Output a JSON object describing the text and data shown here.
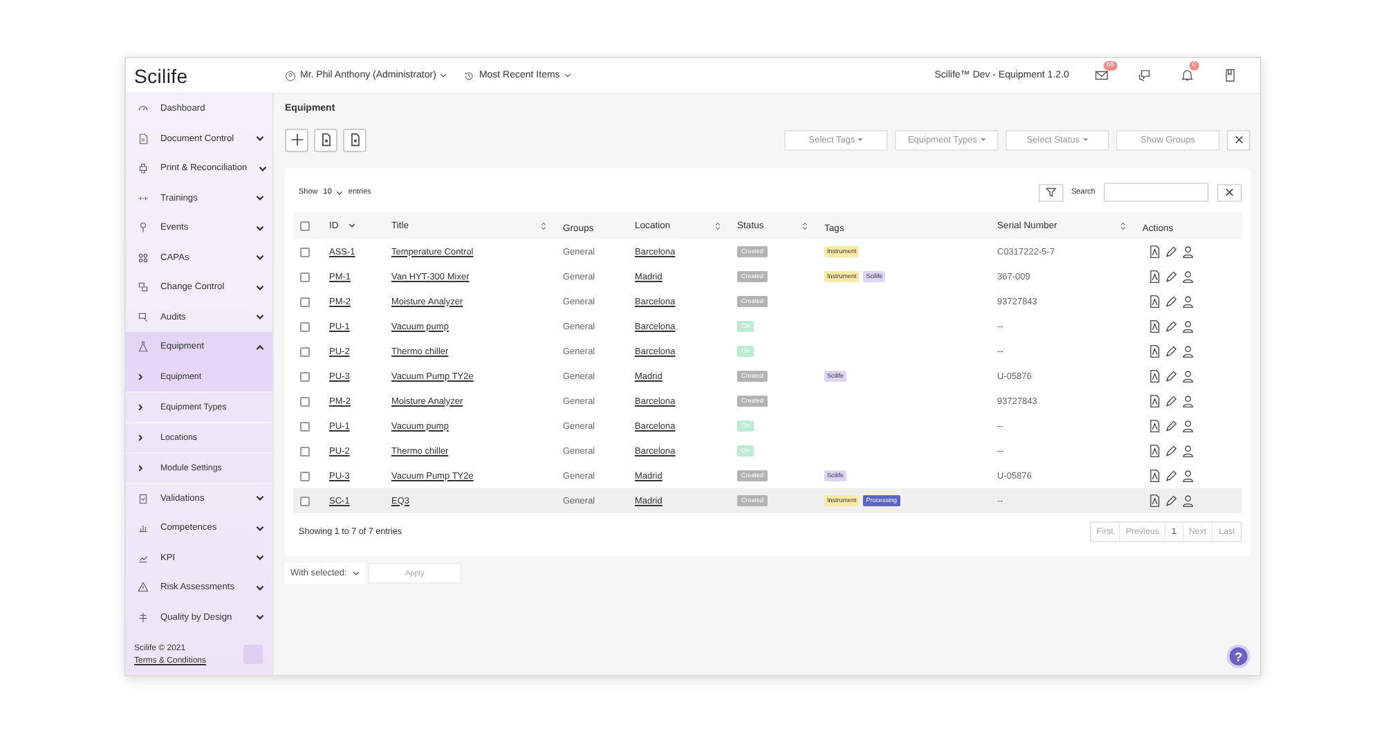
{
  "topbar": {
    "logo": "Scilife",
    "user": "Mr. Phil Anthony (Administrator)",
    "recent": "Most Recent Items",
    "env": "Scilife™ Dev - Equipment 1.2.0",
    "mail_badge": "68",
    "bell_badge": "0"
  },
  "sidebar": {
    "items": [
      {
        "label": "Dashboard",
        "expandable": false,
        "selected": false
      },
      {
        "label": "Document Control",
        "expandable": true,
        "expanded": false,
        "selected": false
      },
      {
        "label": "Print & Reconciliation",
        "expandable": true,
        "expanded": false,
        "selected": false
      },
      {
        "label": "Trainings",
        "expandable": true,
        "expanded": false,
        "selected": false
      },
      {
        "label": "Events",
        "expandable": true,
        "expanded": false,
        "selected": false
      },
      {
        "label": "CAPAs",
        "expandable": true,
        "expanded": false,
        "selected": false
      },
      {
        "label": "Change Control",
        "expandable": true,
        "expanded": false,
        "selected": false
      },
      {
        "label": "Audits",
        "expandable": true,
        "expanded": false,
        "selected": false
      },
      {
        "label": "Equipment",
        "expandable": true,
        "expanded": true,
        "selected": true,
        "children": [
          {
            "label": "Equipment",
            "selected": true
          },
          {
            "label": "Equipment Types",
            "selected": false
          },
          {
            "label": "Locations",
            "selected": false
          },
          {
            "label": "Module Settings",
            "selected": false
          }
        ]
      },
      {
        "label": "Validations",
        "expandable": true,
        "expanded": false,
        "selected": false
      },
      {
        "label": "Competences",
        "expandable": true,
        "expanded": false,
        "selected": false
      },
      {
        "label": "KPI",
        "expandable": true,
        "expanded": false,
        "selected": false
      },
      {
        "label": "Risk Assessments",
        "expandable": true,
        "expanded": false,
        "selected": false
      },
      {
        "label": "Quality by Design",
        "expandable": true,
        "expanded": false,
        "selected": false
      }
    ],
    "copyright": "Scilife © 2021",
    "terms": "Terms & Conditions"
  },
  "page": {
    "title": "Equipment",
    "filters": [
      "Select Tags",
      "Equipment Types",
      "Select Status"
    ],
    "show_groups": "Show Groups"
  },
  "table": {
    "show": "Show",
    "length": "10",
    "entries": "entries",
    "search_label": "Search",
    "select_all_checked": false,
    "columns": [
      {
        "label": "ID",
        "sortable": true,
        "sorted": true
      },
      {
        "label": "Title",
        "sortable": true,
        "sorted": false
      },
      {
        "label": "Groups",
        "sortable": false
      },
      {
        "label": "Location",
        "sortable": true,
        "sorted": false
      },
      {
        "label": "Status",
        "sortable": true,
        "sorted": false
      },
      {
        "label": "Tags",
        "sortable": false
      },
      {
        "label": "Serial Number",
        "sortable": true,
        "sorted": false
      },
      {
        "label": "Actions",
        "sortable": false
      }
    ],
    "rows": [
      {
        "id": "ASS-1",
        "title": "Temperature Control",
        "group": "General",
        "location": "Barcelona",
        "status": {
          "label": "Created",
          "color": "#b3b3b3"
        },
        "tags": [
          {
            "label": "Instrument",
            "color": "#fbe9a6"
          }
        ],
        "serial": "C0317222-5-7",
        "checked": false,
        "highlighted": false
      },
      {
        "id": "PM-1",
        "title": "Van HYT-300 Mixer",
        "group": "General",
        "location": "Madrid",
        "status": {
          "label": "Created",
          "color": "#b3b3b3"
        },
        "tags": [
          {
            "label": "Instrument",
            "color": "#fbe9a6"
          },
          {
            "label": "Scilife",
            "color": "#ddd4f7"
          }
        ],
        "serial": "367-009",
        "checked": false,
        "highlighted": false
      },
      {
        "id": "PM-2",
        "title": "Moisture Analyzer",
        "group": "General",
        "location": "Barcelona",
        "status": {
          "label": "Created",
          "color": "#b3b3b3"
        },
        "tags": [],
        "serial": "93727843",
        "checked": false,
        "highlighted": false
      },
      {
        "id": "PU-1",
        "title": "Vacuum pump",
        "group": "General",
        "location": "Barcelona",
        "status": {
          "label": "On",
          "color": "#bdecd4"
        },
        "tags": [],
        "serial": "--",
        "checked": false,
        "highlighted": false
      },
      {
        "id": "PU-2",
        "title": "Thermo chiller",
        "group": "General",
        "location": "Barcelona",
        "status": {
          "label": "On",
          "color": "#bdecd4"
        },
        "tags": [],
        "serial": "--",
        "checked": false,
        "highlighted": false
      },
      {
        "id": "PU-3",
        "title": "Vacuum Pump TY2e",
        "group": "General",
        "location": "Madrid",
        "status": {
          "label": "Created",
          "color": "#b3b3b3"
        },
        "tags": [
          {
            "label": "Scilife",
            "color": "#ddd4f7"
          }
        ],
        "serial": "U-05876",
        "checked": false,
        "highlighted": false
      },
      {
        "id": "PM-2",
        "title": "Moisture Analyzer",
        "group": "General",
        "location": "Barcelona",
        "status": {
          "label": "Created",
          "color": "#b3b3b3"
        },
        "tags": [],
        "serial": "93727843",
        "checked": false,
        "highlighted": false
      },
      {
        "id": "PU-1",
        "title": "Vacuum pump",
        "group": "General",
        "location": "Barcelona",
        "status": {
          "label": "On",
          "color": "#bdecd4"
        },
        "tags": [],
        "serial": "--",
        "checked": false,
        "highlighted": false
      },
      {
        "id": "PU-2",
        "title": "Thermo chiller",
        "group": "General",
        "location": "Barcelona",
        "status": {
          "label": "On",
          "color": "#bdecd4"
        },
        "tags": [],
        "serial": "--",
        "checked": false,
        "highlighted": false
      },
      {
        "id": "PU-3",
        "title": "Vacuum Pump TY2e",
        "group": "General",
        "location": "Madrid",
        "status": {
          "label": "Created",
          "color": "#b3b3b3"
        },
        "tags": [
          {
            "label": "Scilife",
            "color": "#ddd4f7"
          }
        ],
        "serial": "U-05876",
        "checked": false,
        "highlighted": false
      },
      {
        "id": "SC-1",
        "title": "EQ3",
        "group": "General",
        "location": "Madrid",
        "status": {
          "label": "Created",
          "color": "#b3b3b3"
        },
        "tags": [
          {
            "label": "Instrument",
            "color": "#fbe9a6"
          },
          {
            "label": "Processing",
            "color": "#5d63c4"
          }
        ],
        "serial": "--",
        "checked": false,
        "highlighted": true
      }
    ],
    "info": "Showing 1 to 7 of 7 entries",
    "pagination": [
      {
        "label": "First",
        "selected": false
      },
      {
        "label": "Previous",
        "selected": false
      },
      {
        "label": "1",
        "selected": true
      },
      {
        "label": "Next",
        "selected": false
      },
      {
        "label": "Last",
        "selected": false
      }
    ]
  },
  "bulk": {
    "label": "With selected:",
    "apply": "Apply"
  },
  "help": "?"
}
